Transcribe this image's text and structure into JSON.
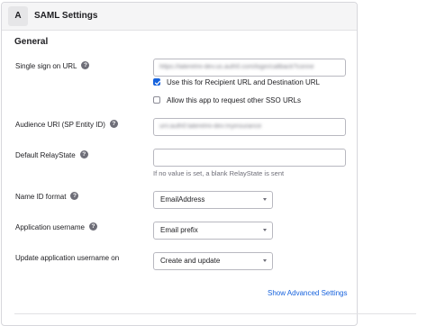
{
  "panel": {
    "step": "A",
    "title": "SAML Settings"
  },
  "section": {
    "title": "General"
  },
  "fields": {
    "sso_url": {
      "label": "Single sign on URL",
      "value": "https://laterelmi-dev.us.auth0.com/login/callback?conne",
      "recipient_checkbox_label": "Use this for Recipient URL and Destination URL",
      "recipient_checked": true,
      "other_sso_label": "Allow this app to request other SSO URLs",
      "other_sso_checked": false
    },
    "audience_uri": {
      "label": "Audience URI (SP Entity ID)",
      "value": "urn:auth0:laterelmi-dev:myinsurance"
    },
    "relay_state": {
      "label": "Default RelayState",
      "value": "",
      "hint": "If no value is set, a blank RelayState is sent"
    },
    "name_id_format": {
      "label": "Name ID format",
      "value": "EmailAddress"
    },
    "app_username": {
      "label": "Application username",
      "value": "Email prefix"
    },
    "update_username": {
      "label": "Update application username on",
      "value": "Create and update"
    }
  },
  "advanced_link": "Show Advanced Settings",
  "icons": {
    "help": "help-circle-icon",
    "checkmark": "checkmark-icon",
    "caret": "chevron-down-icon"
  },
  "colors": {
    "accent": "#1662dd",
    "header_bg": "#f5f5f6",
    "border": "#d7d7dc"
  }
}
